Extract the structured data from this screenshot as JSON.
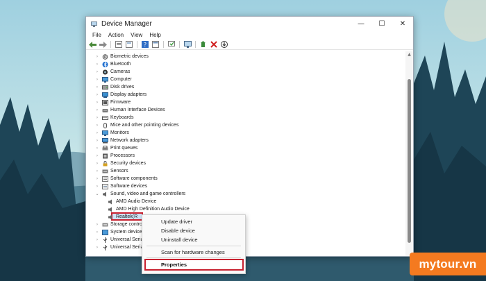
{
  "window": {
    "title": "Device Manager",
    "controls": {
      "minimize": "—",
      "maximize": "☐",
      "close": "✕"
    }
  },
  "menu": [
    "File",
    "Action",
    "View",
    "Help"
  ],
  "toolbar": [
    "back-arrow-icon",
    "forward-arrow-icon",
    "properties-icon",
    "view-icon",
    "help-icon",
    "devices-view-icon",
    "scan-icon",
    "monitor-icon",
    "update-driver-icon",
    "uninstall-x-icon",
    "download-icon"
  ],
  "tree": [
    {
      "label": "Biometric devices",
      "icon": "fingerprint-icon"
    },
    {
      "label": "Bluetooth",
      "icon": "bluetooth-icon"
    },
    {
      "label": "Cameras",
      "icon": "camera-icon"
    },
    {
      "label": "Computer",
      "icon": "computer-icon"
    },
    {
      "label": "Disk drives",
      "icon": "disk-icon"
    },
    {
      "label": "Display adapters",
      "icon": "display-adapter-icon"
    },
    {
      "label": "Firmware",
      "icon": "firmware-icon"
    },
    {
      "label": "Human Interface Devices",
      "icon": "hid-icon"
    },
    {
      "label": "Keyboards",
      "icon": "keyboard-icon"
    },
    {
      "label": "Mice and other pointing devices",
      "icon": "mouse-icon"
    },
    {
      "label": "Monitors",
      "icon": "monitor-icon"
    },
    {
      "label": "Network adapters",
      "icon": "network-icon"
    },
    {
      "label": "Print queues",
      "icon": "printer-icon"
    },
    {
      "label": "Processors",
      "icon": "processor-icon"
    },
    {
      "label": "Security devices",
      "icon": "security-icon"
    },
    {
      "label": "Sensors",
      "icon": "sensor-icon"
    },
    {
      "label": "Software components",
      "icon": "software-component-icon"
    },
    {
      "label": "Software devices",
      "icon": "software-device-icon"
    },
    {
      "label": "Sound, video and game controllers",
      "icon": "speaker-icon",
      "expanded": true
    },
    {
      "label": "AMD Audio Device",
      "icon": "speaker-icon",
      "child": true
    },
    {
      "label": "AMD High Definition Audio Device",
      "icon": "speaker-icon",
      "child": true
    },
    {
      "label": "Realtek(R",
      "icon": "speaker-icon",
      "child": true,
      "selected": true
    },
    {
      "label": "Storage contro",
      "icon": "storage-icon"
    },
    {
      "label": "System devices",
      "icon": "system-icon"
    },
    {
      "label": "Universal Serial",
      "icon": "usb-icon"
    },
    {
      "label": "Universal Serial",
      "icon": "usb-icon"
    }
  ],
  "context_menu": {
    "update_driver": "Update driver",
    "disable_device": "Disable device",
    "uninstall_device": "Uninstall device",
    "scan": "Scan for hardware changes",
    "properties": "Properties"
  },
  "watermark": "mytour.vn",
  "colors": {
    "highlight": "#c8202f",
    "selection": "#cfe3f8",
    "watermark": "#f47a20"
  }
}
